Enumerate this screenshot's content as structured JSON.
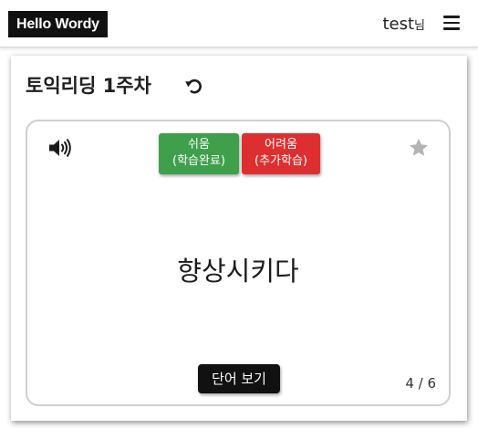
{
  "header": {
    "brand": "Hello Wordy",
    "user_name": "test",
    "user_suffix": "님",
    "menu_icon": "hamburger-menu-icon"
  },
  "panel": {
    "title": "토익리딩 1주차",
    "refresh_icon": "refresh-icon"
  },
  "card": {
    "speaker_icon": "speaker-icon",
    "star_icon": "star-icon",
    "easy_button": {
      "line1": "쉬움",
      "line2": "(학습완료)",
      "color": "#3fa04b"
    },
    "hard_button": {
      "line1": "어려움",
      "line2": "(추가학습)",
      "color": "#dd2f2f"
    },
    "word": "향상시키다",
    "reveal_button": "단어 보기",
    "counter": "4 / 6"
  }
}
